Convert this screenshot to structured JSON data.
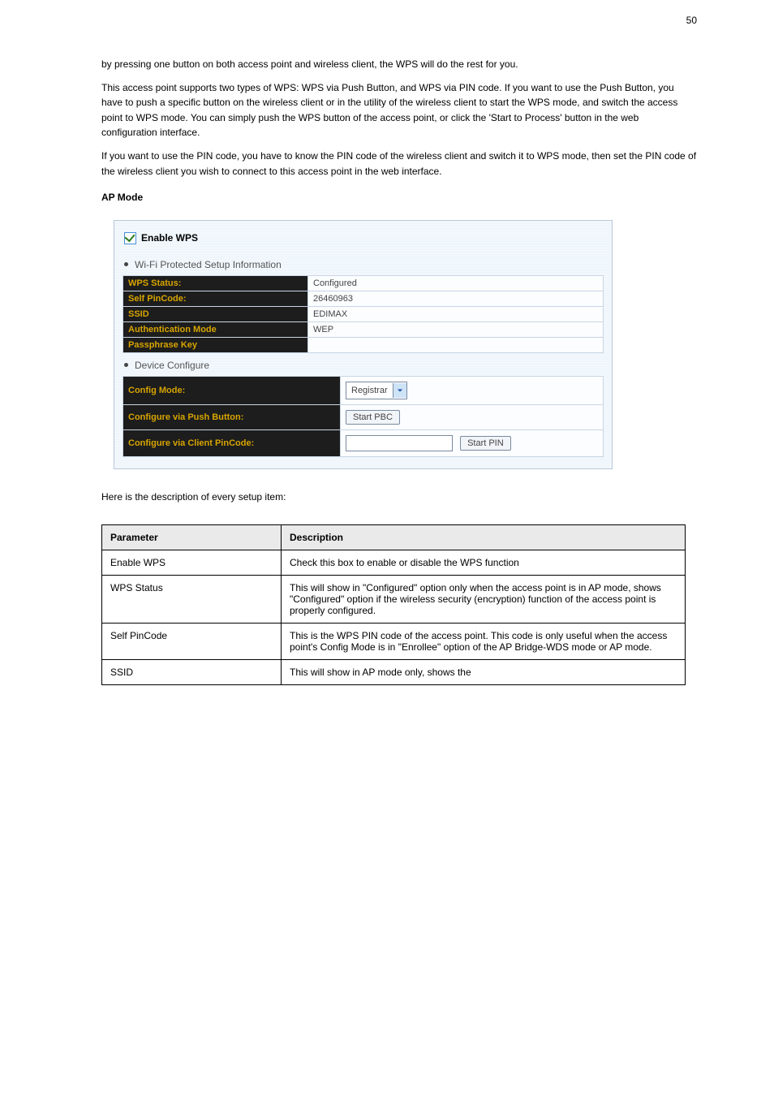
{
  "page": {
    "number": "50"
  },
  "intro": {
    "p1": "by pressing one button on both access point and wireless client, the WPS will do the rest for you.",
    "p2": "This access point supports two types of WPS: WPS via Push Button, and WPS via PIN code. If you want to use the Push Button, you have to push a specific button on the wireless client or in the utility of the wireless client to start the WPS mode, and switch the access point to WPS mode. You can simply push the WPS button of the access point, or click the 'Start to Process' button in the web configuration interface.",
    "p3": "If you want to use the PIN code, you have to know the PIN code of the wireless client and switch it to WPS mode, then set the PIN code of the wireless client you wish to connect to this access point in the web interface.",
    "ap_heading": "AP Mode"
  },
  "panel": {
    "enable_label": "Enable WPS",
    "section1": "Wi-Fi Protected Setup Information",
    "section2": "Device Configure",
    "info": {
      "rows": [
        {
          "label": "WPS Status:",
          "value": "Configured"
        },
        {
          "label": "Self PinCode:",
          "value": "26460963"
        },
        {
          "label": "SSID",
          "value": "EDIMAX"
        },
        {
          "label": "Authentication Mode",
          "value": "WEP"
        },
        {
          "label": "Passphrase Key",
          "value": ""
        }
      ]
    },
    "conf": {
      "rows": [
        {
          "label": "Config Mode:",
          "select_value": "Registrar"
        },
        {
          "label": "Configure via Push Button:",
          "button": "Start PBC"
        },
        {
          "label": "Configure via Client PinCode:",
          "button": "Start PIN"
        }
      ]
    }
  },
  "note": "Here is the description of every setup item:",
  "desc": {
    "header": [
      "Parameter",
      "Description"
    ],
    "rows": [
      {
        "param": "Enable WPS",
        "text": "Check this box to enable or disable the WPS function"
      },
      {
        "param": "WPS Status",
        "text": "This will show in \"Configured\" option only when the access point is in AP mode, shows \"Configured\" option if the wireless security (encryption) function of the access point is properly configured."
      },
      {
        "param": "Self PinCode",
        "text": "This is the WPS PIN code of the access point. This code is only useful when the access point's Config Mode is in \"Enrollee\" option of the AP Bridge-WDS mode or AP mode."
      },
      {
        "param": "SSID",
        "text": "This will show in AP mode only, shows the"
      }
    ]
  }
}
